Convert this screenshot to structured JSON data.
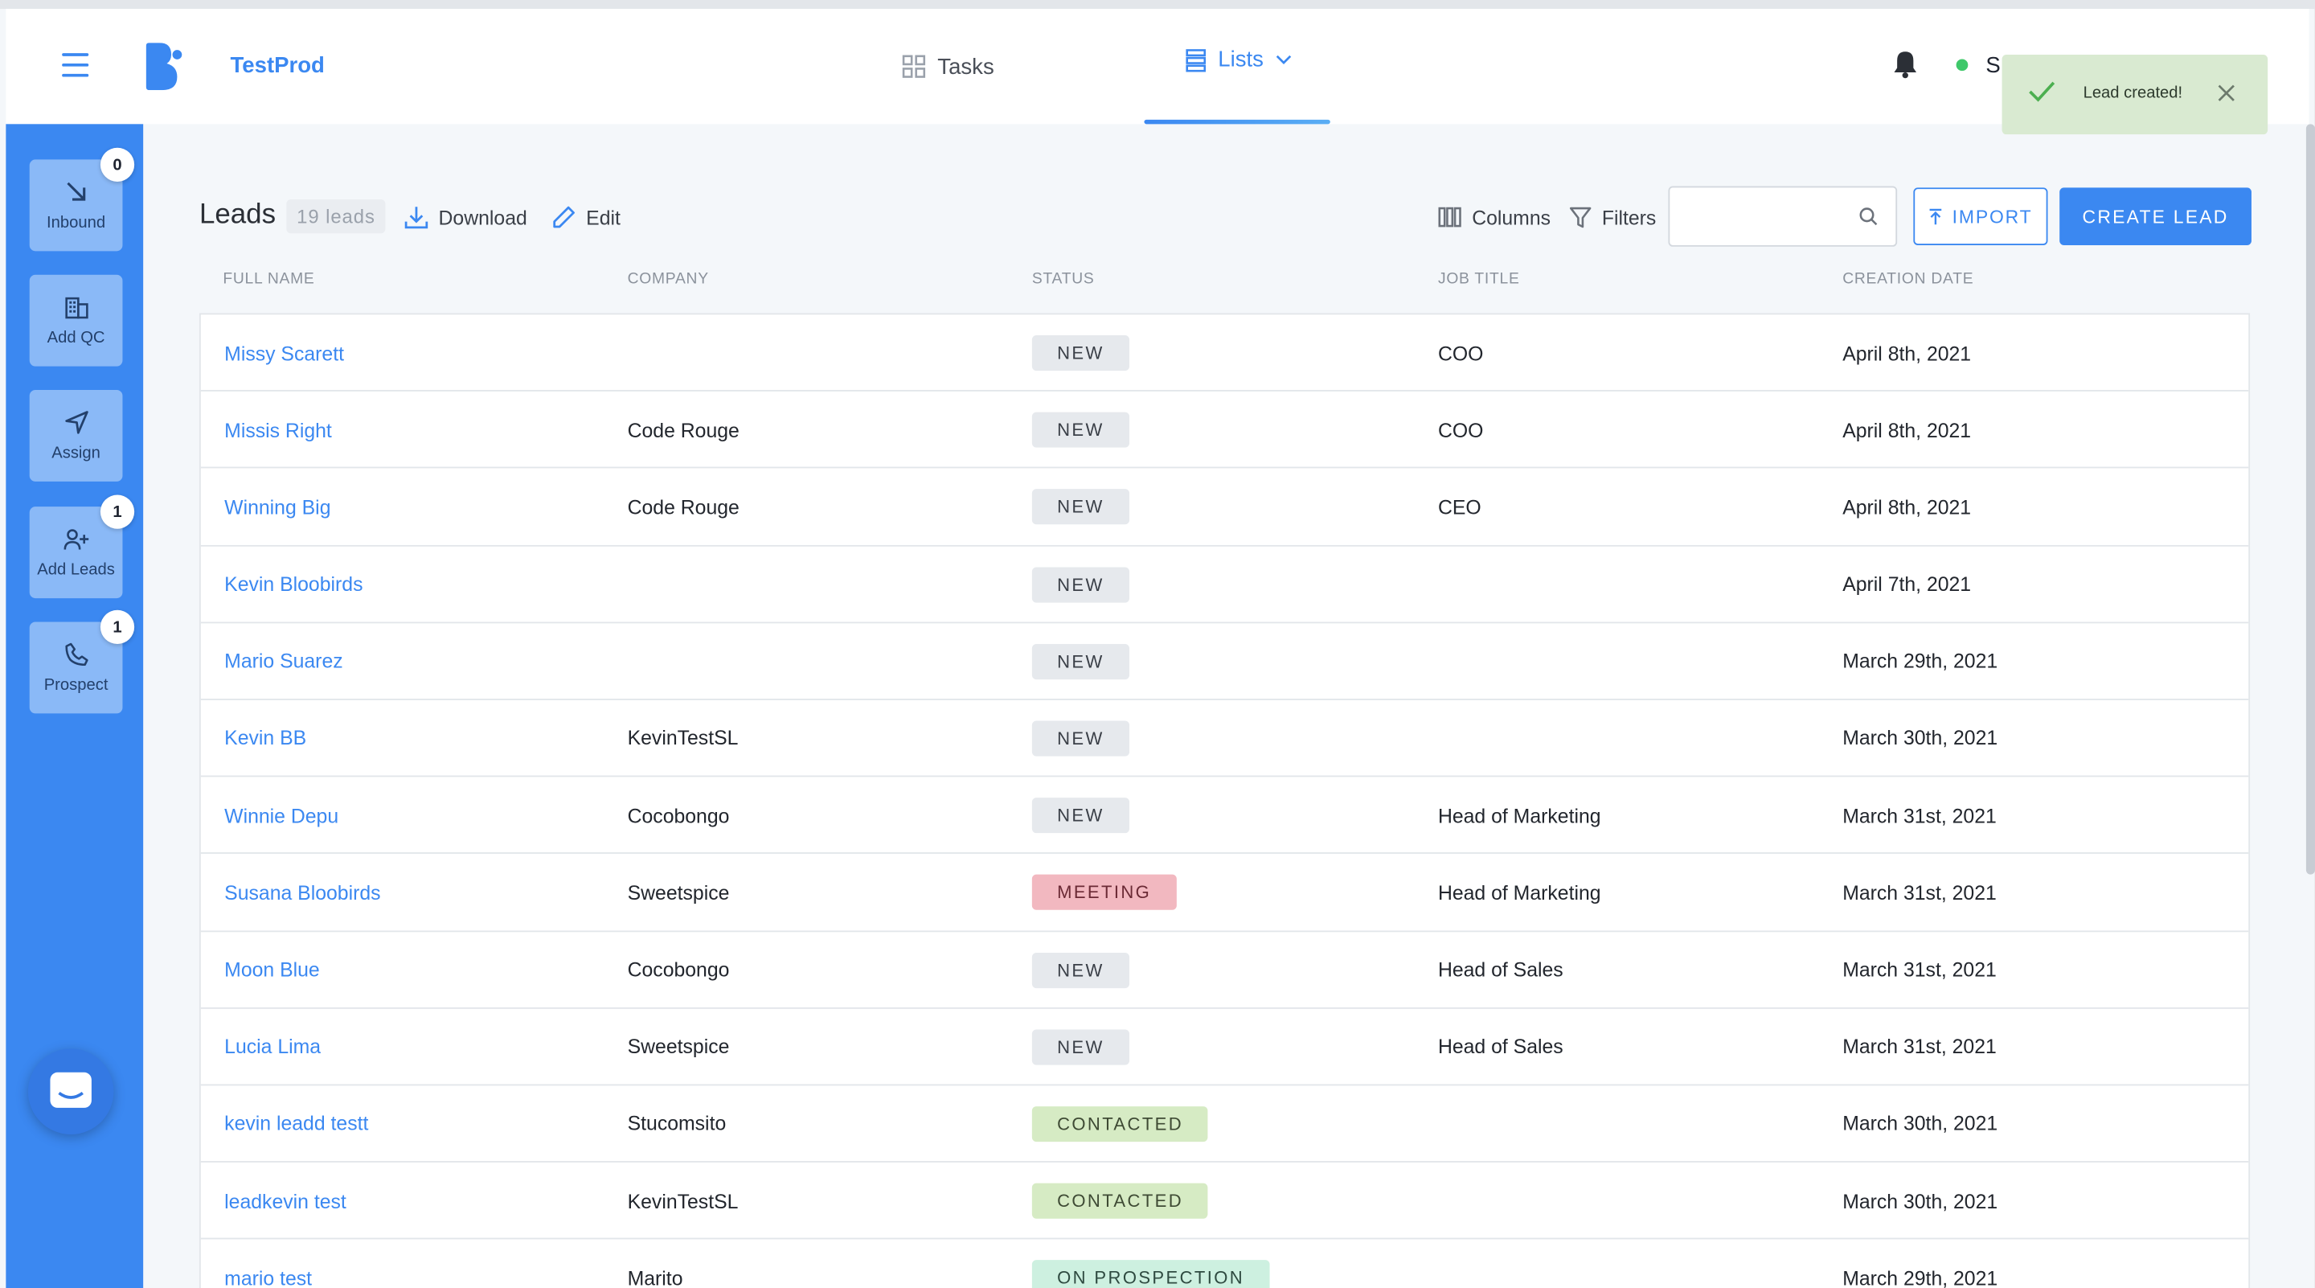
{
  "app": {
    "name": "TestProd",
    "user_initial": "S"
  },
  "nav": {
    "tasks_label": "Tasks",
    "lists_label": "Lists"
  },
  "toast": {
    "message": "Lead created!"
  },
  "sidebar": {
    "items": [
      {
        "label": "Inbound",
        "badge": "0"
      },
      {
        "label": "Add QC",
        "badge": ""
      },
      {
        "label": "Assign",
        "badge": ""
      },
      {
        "label": "Add Leads",
        "badge": "1"
      },
      {
        "label": "Prospect",
        "badge": "1"
      }
    ]
  },
  "toolbar": {
    "title": "Leads",
    "count": "19 leads",
    "download_label": "Download",
    "edit_label": "Edit",
    "columns_label": "Columns",
    "filters_label": "Filters",
    "search_placeholder": "",
    "import_label": "IMPORT",
    "create_label": "CREATE LEAD"
  },
  "table": {
    "headers": [
      "FULL NAME",
      "COMPANY",
      "STATUS",
      "JOB TITLE",
      "CREATION DATE"
    ],
    "rows": [
      {
        "name": "Missy Scarett",
        "company": "",
        "status": "NEW",
        "status_kind": "new",
        "job": "COO",
        "date": "April 8th, 2021"
      },
      {
        "name": "Missis Right",
        "company": "Code Rouge",
        "status": "NEW",
        "status_kind": "new",
        "job": "COO",
        "date": "April 8th, 2021"
      },
      {
        "name": "Winning Big",
        "company": "Code Rouge",
        "status": "NEW",
        "status_kind": "new",
        "job": "CEO",
        "date": "April 8th, 2021"
      },
      {
        "name": "Kevin Bloobirds",
        "company": "",
        "status": "NEW",
        "status_kind": "new",
        "job": "",
        "date": "April 7th, 2021"
      },
      {
        "name": "Mario Suarez",
        "company": "",
        "status": "NEW",
        "status_kind": "new",
        "job": "",
        "date": "March 29th, 2021"
      },
      {
        "name": "Kevin BB",
        "company": "KevinTestSL",
        "status": "NEW",
        "status_kind": "new",
        "job": "",
        "date": "March 30th, 2021"
      },
      {
        "name": "Winnie Depu",
        "company": "Cocobongo",
        "status": "NEW",
        "status_kind": "new",
        "job": "Head of Marketing",
        "date": "March 31st, 2021"
      },
      {
        "name": "Susana Bloobirds",
        "company": "Sweetspice",
        "status": "MEETING",
        "status_kind": "meeting",
        "job": "Head of Marketing",
        "date": "March 31st, 2021"
      },
      {
        "name": "Moon Blue",
        "company": "Cocobongo",
        "status": "NEW",
        "status_kind": "new",
        "job": "Head of Sales",
        "date": "March 31st, 2021"
      },
      {
        "name": "Lucia Lima",
        "company": "Sweetspice",
        "status": "NEW",
        "status_kind": "new",
        "job": "Head of Sales",
        "date": "March 31st, 2021"
      },
      {
        "name": "kevin leadd testt",
        "company": "Stucomsito",
        "status": "CONTACTED",
        "status_kind": "contacted",
        "job": "",
        "date": "March 30th, 2021"
      },
      {
        "name": "leadkevin test",
        "company": "KevinTestSL",
        "status": "CONTACTED",
        "status_kind": "contacted",
        "job": "",
        "date": "March 30th, 2021"
      },
      {
        "name": "mario test",
        "company": "Marito",
        "status": "ON PROSPECTION",
        "status_kind": "prospection",
        "job": "",
        "date": "March 29th, 2021"
      }
    ]
  },
  "colors": {
    "accent": "#3b88f1",
    "sidebar": "#3b88f1",
    "toast_bg": "#d9ead1"
  }
}
